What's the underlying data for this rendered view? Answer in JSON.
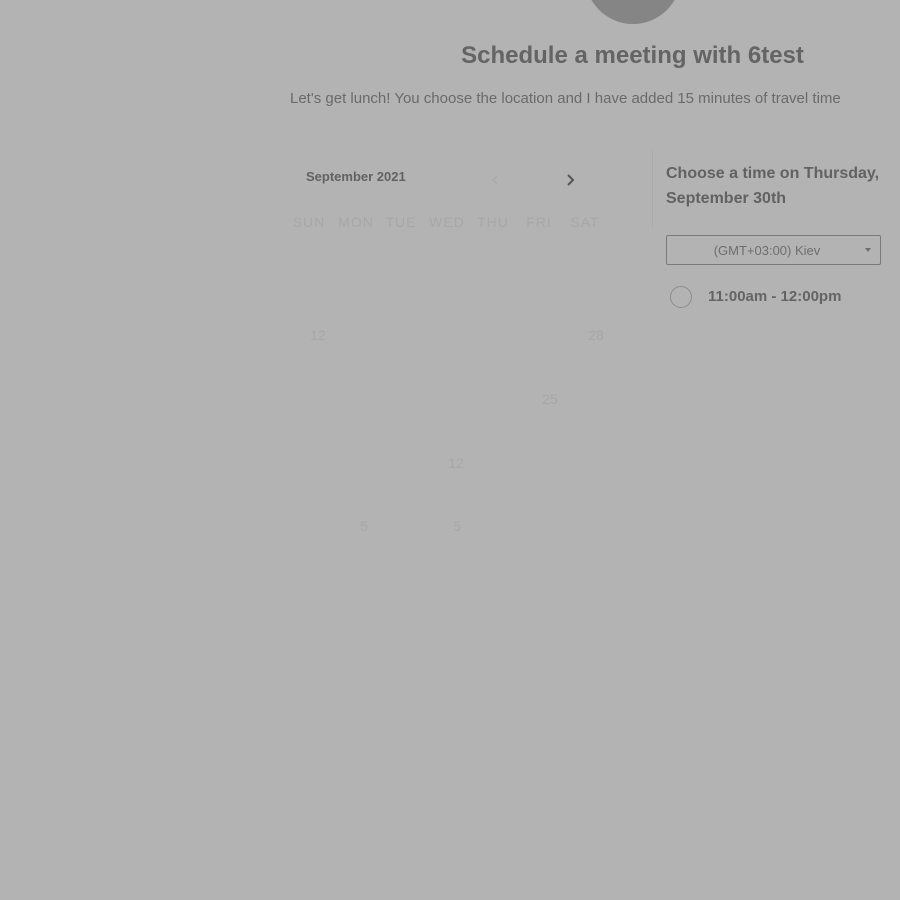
{
  "header": {
    "title": "Schedule a meeting with 6test",
    "description": "Let's get lunch! You choose the location and I have added 15 minutes of travel time"
  },
  "calendar": {
    "month_label": "September 2021",
    "weekdays": [
      "SUN",
      "MON",
      "TUE",
      "WED",
      "THU",
      "FRI",
      "SAT"
    ],
    "visible_days": [
      "12",
      "28",
      "25",
      "12",
      "5",
      "5"
    ],
    "prev_icon": "chevron-left-icon",
    "next_icon": "chevron-right-icon"
  },
  "time_panel": {
    "heading": "Choose a time on Thursday, September 30th",
    "timezone": "(GMT+03:00) Kiev",
    "slots": [
      {
        "label": "11:00am - 12:00pm"
      }
    ]
  },
  "colors": {
    "overlay_background": "#b3b3b3",
    "text_strong": "#646464",
    "text_faded": "#a7a7a7"
  }
}
